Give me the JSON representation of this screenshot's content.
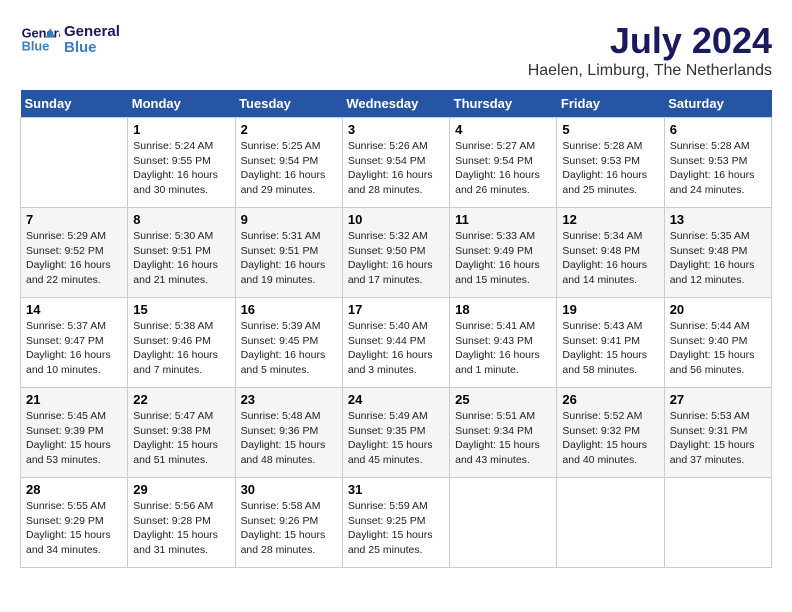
{
  "header": {
    "logo_line1": "General",
    "logo_line2": "Blue",
    "month_year": "July 2024",
    "location": "Haelen, Limburg, The Netherlands"
  },
  "days_of_week": [
    "Sunday",
    "Monday",
    "Tuesday",
    "Wednesday",
    "Thursday",
    "Friday",
    "Saturday"
  ],
  "weeks": [
    [
      {
        "day": "",
        "info": ""
      },
      {
        "day": "1",
        "info": "Sunrise: 5:24 AM\nSunset: 9:55 PM\nDaylight: 16 hours\nand 30 minutes."
      },
      {
        "day": "2",
        "info": "Sunrise: 5:25 AM\nSunset: 9:54 PM\nDaylight: 16 hours\nand 29 minutes."
      },
      {
        "day": "3",
        "info": "Sunrise: 5:26 AM\nSunset: 9:54 PM\nDaylight: 16 hours\nand 28 minutes."
      },
      {
        "day": "4",
        "info": "Sunrise: 5:27 AM\nSunset: 9:54 PM\nDaylight: 16 hours\nand 26 minutes."
      },
      {
        "day": "5",
        "info": "Sunrise: 5:28 AM\nSunset: 9:53 PM\nDaylight: 16 hours\nand 25 minutes."
      },
      {
        "day": "6",
        "info": "Sunrise: 5:28 AM\nSunset: 9:53 PM\nDaylight: 16 hours\nand 24 minutes."
      }
    ],
    [
      {
        "day": "7",
        "info": "Sunrise: 5:29 AM\nSunset: 9:52 PM\nDaylight: 16 hours\nand 22 minutes."
      },
      {
        "day": "8",
        "info": "Sunrise: 5:30 AM\nSunset: 9:51 PM\nDaylight: 16 hours\nand 21 minutes."
      },
      {
        "day": "9",
        "info": "Sunrise: 5:31 AM\nSunset: 9:51 PM\nDaylight: 16 hours\nand 19 minutes."
      },
      {
        "day": "10",
        "info": "Sunrise: 5:32 AM\nSunset: 9:50 PM\nDaylight: 16 hours\nand 17 minutes."
      },
      {
        "day": "11",
        "info": "Sunrise: 5:33 AM\nSunset: 9:49 PM\nDaylight: 16 hours\nand 15 minutes."
      },
      {
        "day": "12",
        "info": "Sunrise: 5:34 AM\nSunset: 9:48 PM\nDaylight: 16 hours\nand 14 minutes."
      },
      {
        "day": "13",
        "info": "Sunrise: 5:35 AM\nSunset: 9:48 PM\nDaylight: 16 hours\nand 12 minutes."
      }
    ],
    [
      {
        "day": "14",
        "info": "Sunrise: 5:37 AM\nSunset: 9:47 PM\nDaylight: 16 hours\nand 10 minutes."
      },
      {
        "day": "15",
        "info": "Sunrise: 5:38 AM\nSunset: 9:46 PM\nDaylight: 16 hours\nand 7 minutes."
      },
      {
        "day": "16",
        "info": "Sunrise: 5:39 AM\nSunset: 9:45 PM\nDaylight: 16 hours\nand 5 minutes."
      },
      {
        "day": "17",
        "info": "Sunrise: 5:40 AM\nSunset: 9:44 PM\nDaylight: 16 hours\nand 3 minutes."
      },
      {
        "day": "18",
        "info": "Sunrise: 5:41 AM\nSunset: 9:43 PM\nDaylight: 16 hours\nand 1 minute."
      },
      {
        "day": "19",
        "info": "Sunrise: 5:43 AM\nSunset: 9:41 PM\nDaylight: 15 hours\nand 58 minutes."
      },
      {
        "day": "20",
        "info": "Sunrise: 5:44 AM\nSunset: 9:40 PM\nDaylight: 15 hours\nand 56 minutes."
      }
    ],
    [
      {
        "day": "21",
        "info": "Sunrise: 5:45 AM\nSunset: 9:39 PM\nDaylight: 15 hours\nand 53 minutes."
      },
      {
        "day": "22",
        "info": "Sunrise: 5:47 AM\nSunset: 9:38 PM\nDaylight: 15 hours\nand 51 minutes."
      },
      {
        "day": "23",
        "info": "Sunrise: 5:48 AM\nSunset: 9:36 PM\nDaylight: 15 hours\nand 48 minutes."
      },
      {
        "day": "24",
        "info": "Sunrise: 5:49 AM\nSunset: 9:35 PM\nDaylight: 15 hours\nand 45 minutes."
      },
      {
        "day": "25",
        "info": "Sunrise: 5:51 AM\nSunset: 9:34 PM\nDaylight: 15 hours\nand 43 minutes."
      },
      {
        "day": "26",
        "info": "Sunrise: 5:52 AM\nSunset: 9:32 PM\nDaylight: 15 hours\nand 40 minutes."
      },
      {
        "day": "27",
        "info": "Sunrise: 5:53 AM\nSunset: 9:31 PM\nDaylight: 15 hours\nand 37 minutes."
      }
    ],
    [
      {
        "day": "28",
        "info": "Sunrise: 5:55 AM\nSunset: 9:29 PM\nDaylight: 15 hours\nand 34 minutes."
      },
      {
        "day": "29",
        "info": "Sunrise: 5:56 AM\nSunset: 9:28 PM\nDaylight: 15 hours\nand 31 minutes."
      },
      {
        "day": "30",
        "info": "Sunrise: 5:58 AM\nSunset: 9:26 PM\nDaylight: 15 hours\nand 28 minutes."
      },
      {
        "day": "31",
        "info": "Sunrise: 5:59 AM\nSunset: 9:25 PM\nDaylight: 15 hours\nand 25 minutes."
      },
      {
        "day": "",
        "info": ""
      },
      {
        "day": "",
        "info": ""
      },
      {
        "day": "",
        "info": ""
      }
    ]
  ]
}
